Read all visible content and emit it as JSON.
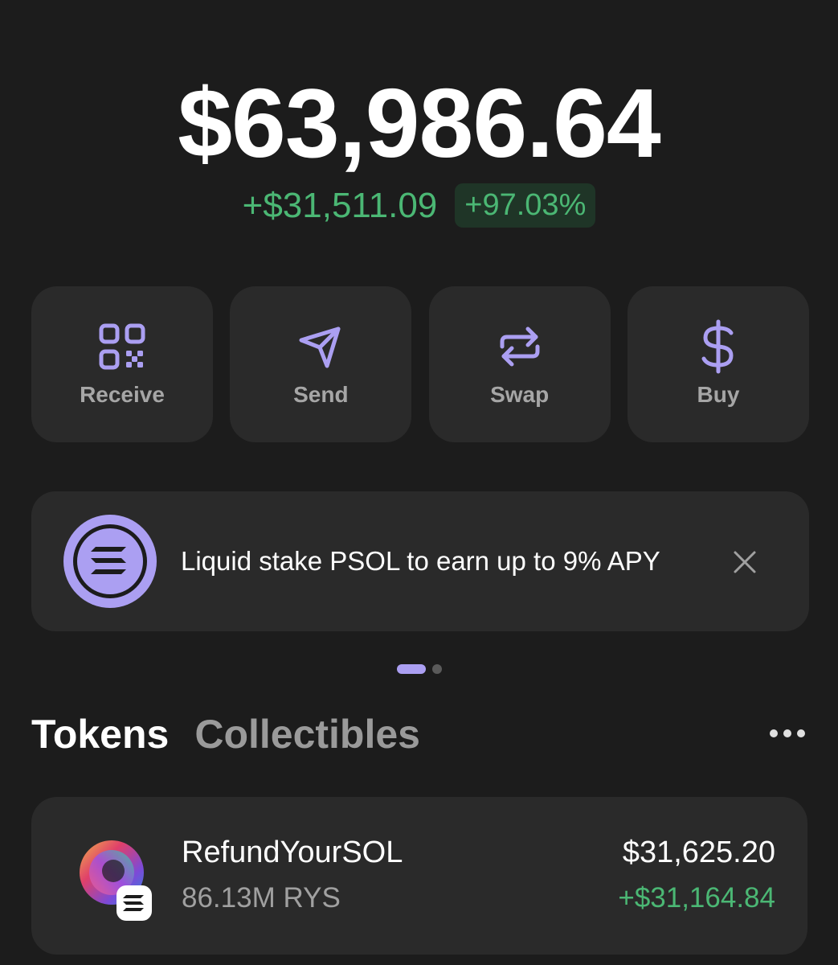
{
  "portfolio": {
    "balance": "$63,986.64",
    "change_amount": "+$31,511.09",
    "change_percent": "+97.03%"
  },
  "actions": [
    {
      "label": "Receive",
      "icon": "qr-code-icon"
    },
    {
      "label": "Send",
      "icon": "paper-plane-icon"
    },
    {
      "label": "Swap",
      "icon": "swap-arrows-icon"
    },
    {
      "label": "Buy",
      "icon": "dollar-icon"
    }
  ],
  "promo": {
    "text": "Liquid stake PSOL to earn up to 9% APY",
    "icon": "solana-icon",
    "close_icon": "close-icon"
  },
  "carousel": {
    "active_index": 0,
    "count": 2
  },
  "tabs": [
    {
      "label": "Tokens",
      "active": true
    },
    {
      "label": "Collectibles",
      "active": false
    }
  ],
  "tokens": [
    {
      "name": "RefundYourSOL",
      "amount": "86.13M RYS",
      "value": "$31,625.20",
      "change": "+$31,164.84",
      "icon": "token-logo-icon"
    }
  ],
  "colors": {
    "background": "#1c1c1c",
    "card": "#2a2a2a",
    "accent": "#ab9ff2",
    "positive": "#4bb774"
  }
}
